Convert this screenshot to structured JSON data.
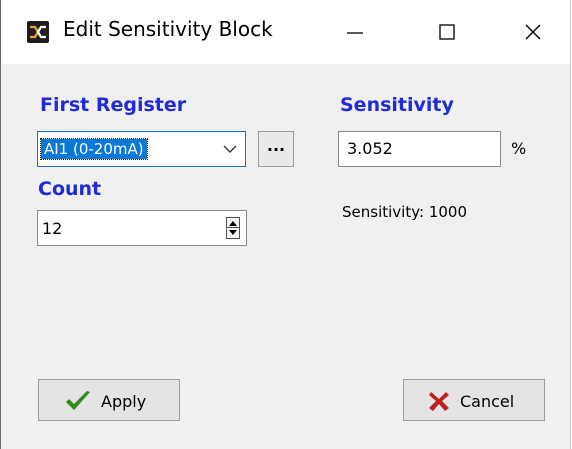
{
  "window": {
    "title": "Edit Sensitivity Block",
    "icons": {
      "app": "app-logo-icon",
      "minimize": "minimize-icon",
      "maximize": "maximize-icon",
      "close": "close-icon"
    }
  },
  "first_register": {
    "label": "First Register",
    "selected_value": "AI1 (0-20mA)",
    "browse_label": "..."
  },
  "count": {
    "label": "Count",
    "value": "12"
  },
  "sensitivity": {
    "label": "Sensitivity",
    "value": "3.052",
    "unit": "%",
    "info_text": "Sensitivity: 1000"
  },
  "buttons": {
    "apply_label": "Apply",
    "cancel_label": "Cancel",
    "apply_icon": "checkmark-icon",
    "cancel_icon": "x-mark-icon"
  },
  "colors": {
    "label_blue": "#1f2bd6",
    "selection_blue": "#0a78d7",
    "apply_green": "#2e8b1e",
    "cancel_red": "#c0201a"
  }
}
